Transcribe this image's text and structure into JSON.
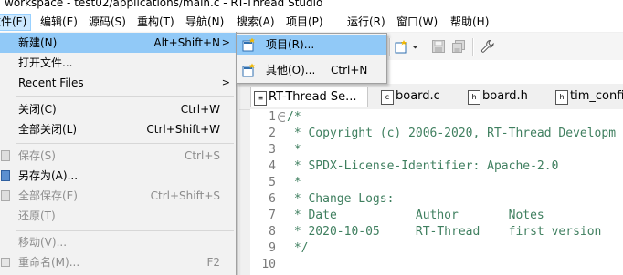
{
  "window": {
    "title": "workspace - test02/applications/main.c - RT-Thread Studio"
  },
  "menubar": {
    "items": [
      {
        "label": "文件(F)"
      },
      {
        "label": "编辑(E)"
      },
      {
        "label": "源码(S)"
      },
      {
        "label": "重构(T)"
      },
      {
        "label": "导航(N)"
      },
      {
        "label": "搜索(A)"
      },
      {
        "label": "项目(P)"
      },
      {
        "label": "运行(R)"
      },
      {
        "label": "窗口(W)"
      },
      {
        "label": "帮助(H)"
      }
    ]
  },
  "file_menu": {
    "items": [
      {
        "label": "新建(N)",
        "shortcut": "Alt+Shift+N",
        "arrow": ">"
      },
      {
        "label": "打开文件..."
      },
      {
        "label": "Recent Files",
        "arrow": ">"
      },
      {
        "label": "关闭(C)",
        "shortcut": "Ctrl+W"
      },
      {
        "label": "全部关闭(L)",
        "shortcut": "Ctrl+Shift+W"
      },
      {
        "label": "保存(S)",
        "shortcut": "Ctrl+S"
      },
      {
        "label": "另存为(A)..."
      },
      {
        "label": "全部保存(E)",
        "shortcut": "Ctrl+Shift+S"
      },
      {
        "label": "还原(T)"
      },
      {
        "label": "移动(V)..."
      },
      {
        "label": "重命名(M)...",
        "shortcut": "F2"
      }
    ]
  },
  "new_submenu": {
    "items": [
      {
        "label": "项目(R)..."
      },
      {
        "label": "其他(O)...",
        "shortcut": "Ctrl+N"
      }
    ]
  },
  "editor_tabs": [
    {
      "label": "RT-Thread Se...",
      "icon": "settings-file-icon"
    },
    {
      "label": "board.c",
      "icon": "c-file-icon"
    },
    {
      "label": "board.h",
      "icon": "h-file-icon"
    },
    {
      "label": "tim_config",
      "icon": "h-file-icon"
    }
  ],
  "code": {
    "line_numbers": [
      "1",
      "2",
      "3",
      "4",
      "5",
      "6",
      "7",
      "8",
      "9",
      "10"
    ],
    "lines": [
      "/*",
      " * Copyright (c) 2006-2020, RT-Thread Developm",
      " *",
      " * SPDX-License-Identifier: Apache-2.0",
      " *",
      " * Change Logs:",
      " * Date           Author       Notes",
      " * 2020-10-05     RT-Thread    first version",
      " */",
      ""
    ]
  },
  "colors": {
    "comment": "#3f7f5f",
    "highlight": "#91c9f7",
    "menu_bg": "#f2f2f2"
  }
}
